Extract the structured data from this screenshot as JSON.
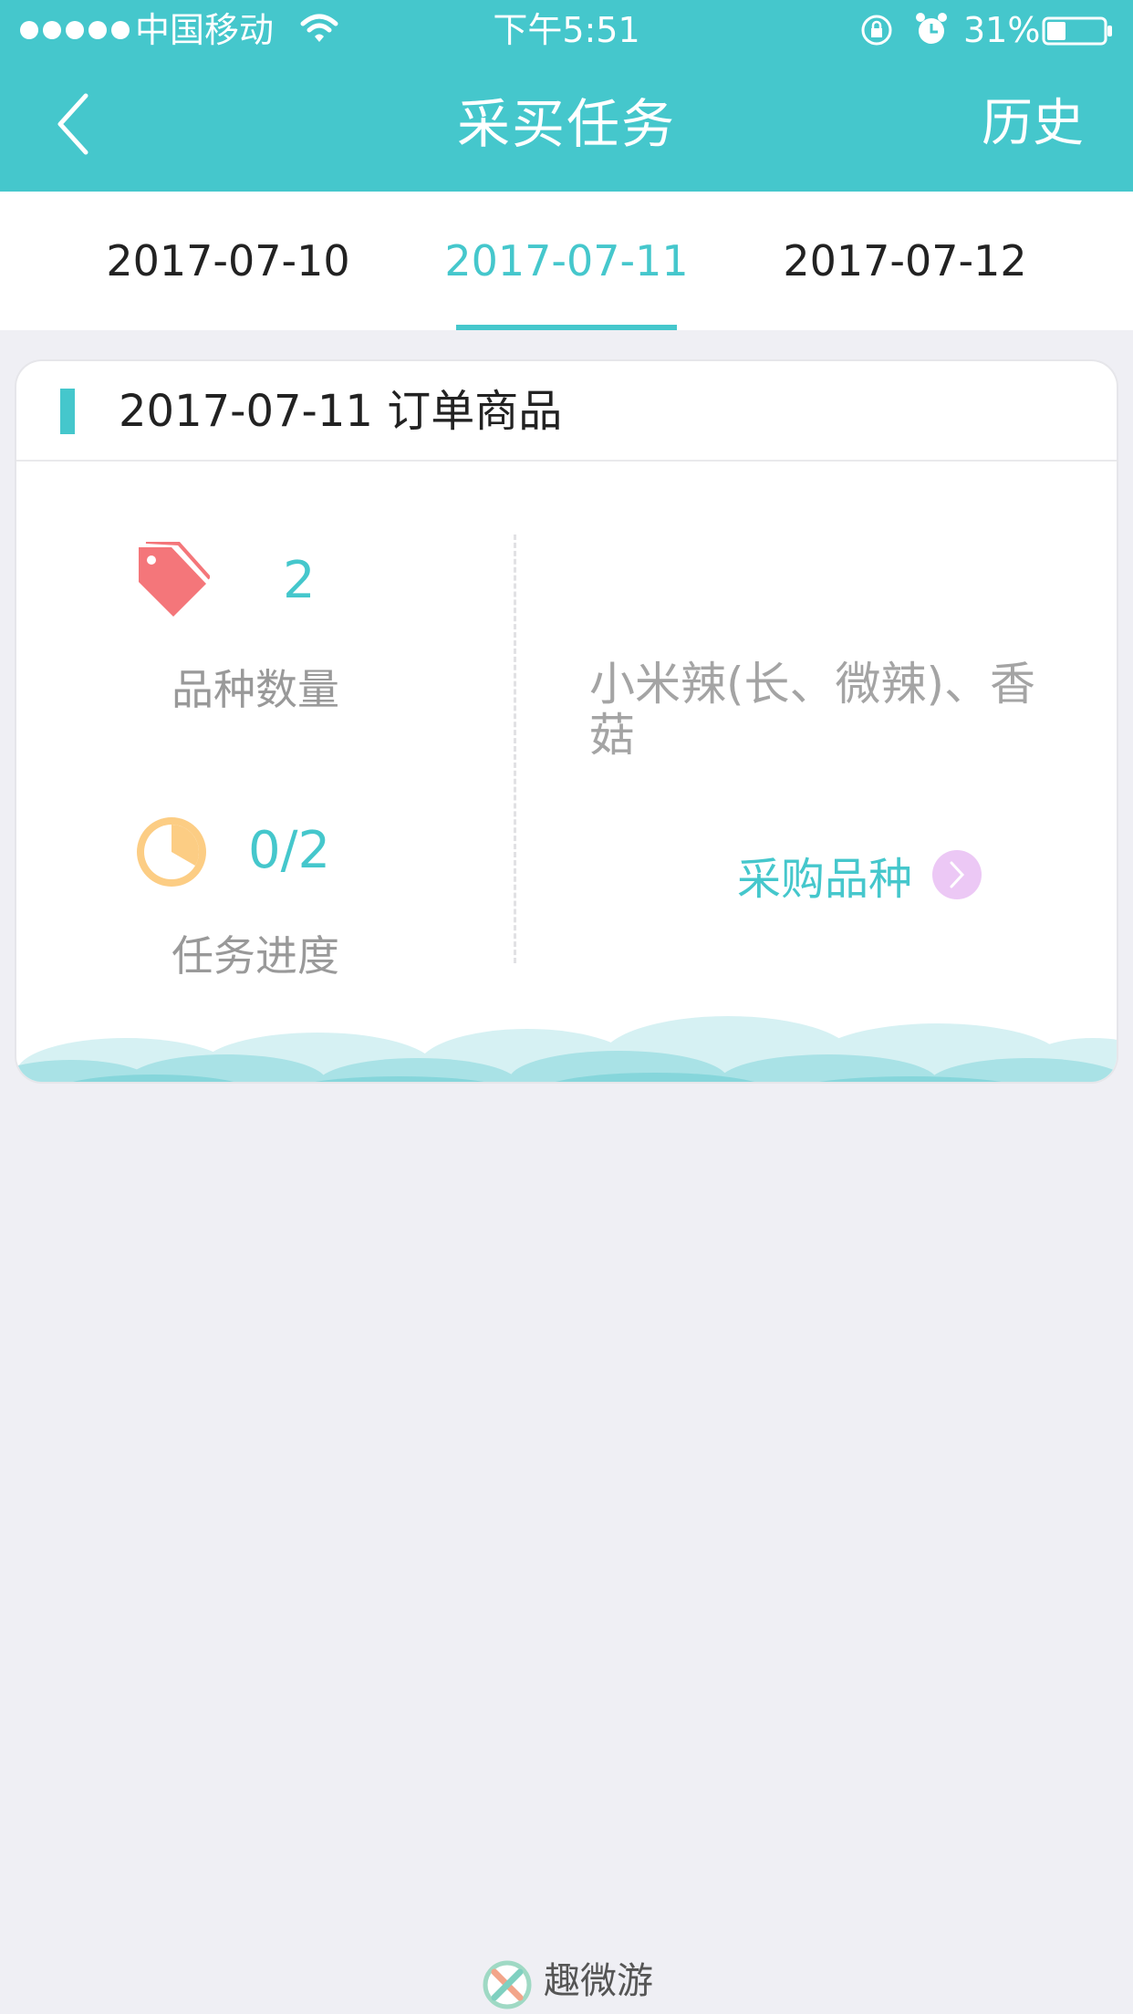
{
  "status_bar": {
    "carrier": "中国移动",
    "time": "下午5:51",
    "battery": "31%"
  },
  "nav": {
    "title": "采买任务",
    "right_button": "历史"
  },
  "tabs": [
    {
      "label": "2017-07-10",
      "active": false
    },
    {
      "label": "2017-07-11",
      "active": true
    },
    {
      "label": "2017-07-12",
      "active": false
    }
  ],
  "card": {
    "title": "2017-07-11  订单商品",
    "variety_count": "2",
    "variety_label": "品种数量",
    "progress_value": "0/2",
    "progress_fraction": 0.0,
    "progress_label": "任务进度",
    "varieties": "小米辣(长、微辣)、香菇",
    "purchase_link": "采购品种"
  },
  "watermark": {
    "brand": "趣微游"
  },
  "colors": {
    "accent": "#45c7cc",
    "tag": "#f4767a",
    "progress": "#fccd84",
    "arrow_bg": "#ecc8f5",
    "background": "#efeff4"
  }
}
